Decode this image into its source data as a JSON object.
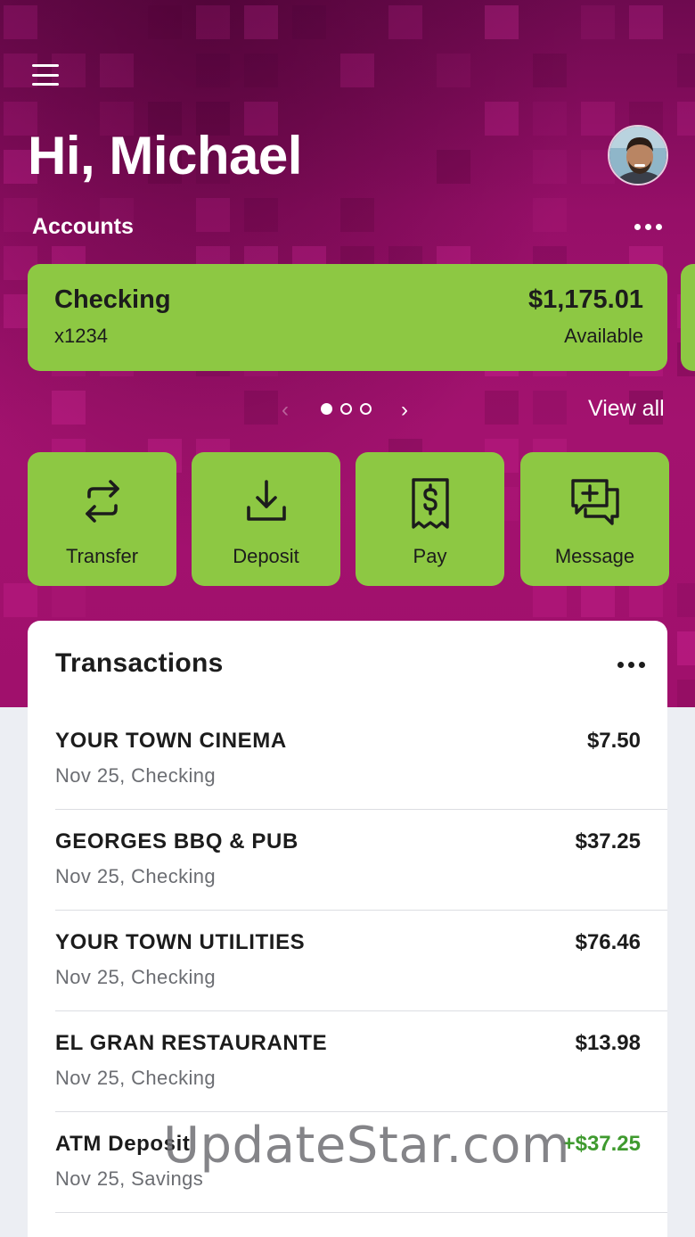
{
  "header": {
    "greeting": "Hi, Michael",
    "accounts_label": "Accounts"
  },
  "account": {
    "name": "Checking",
    "number": "x1234",
    "balance": "$1,175.01",
    "balance_label": "Available"
  },
  "pager": {
    "prev": "‹",
    "next": "›",
    "view_all": "View all"
  },
  "actions": [
    {
      "label": "Transfer",
      "icon": "transfer-icon"
    },
    {
      "label": "Deposit",
      "icon": "deposit-icon"
    },
    {
      "label": "Pay",
      "icon": "pay-bill-icon"
    },
    {
      "label": "Message",
      "icon": "message-icon"
    }
  ],
  "transactions": {
    "title": "Transactions",
    "items": [
      {
        "name": "YOUR TOWN CINEMA",
        "meta": "Nov 25, Checking",
        "amount": "$7.50"
      },
      {
        "name": "GEORGES BBQ & PUB",
        "meta": "Nov 25, Checking",
        "amount": "$37.25"
      },
      {
        "name": "YOUR TOWN UTILITIES",
        "meta": "Nov 25, Checking",
        "amount": "$76.46"
      },
      {
        "name": "EL GRAN RESTAURANTE",
        "meta": "Nov 25, Checking",
        "amount": "$13.98"
      },
      {
        "name": "ATM Deposit",
        "meta": "Nov 25, Savings",
        "amount": "+$37.25"
      }
    ]
  },
  "watermark": "UpdateStar.com",
  "colors": {
    "brand": "#9b0e6a",
    "accent": "#8dc843",
    "credit": "#3f9a2f"
  }
}
